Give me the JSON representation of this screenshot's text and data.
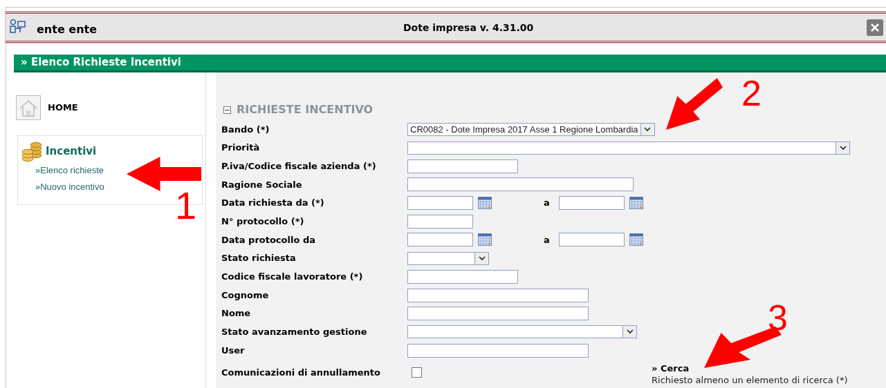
{
  "window": {
    "user": "ente ente",
    "title": "Dote impresa v. 4.31.00"
  },
  "page_header": "» Elenco Richieste Incentivi",
  "sidebar": {
    "home": "HOME",
    "section": "Incentivi",
    "items": [
      {
        "label": "»Elenco richieste"
      },
      {
        "label": "»Nuovo incentivo"
      }
    ]
  },
  "form": {
    "legend": "RICHIESTE INCENTIVO",
    "expanded": true,
    "fields": [
      {
        "label": "Bando (*)",
        "kind": "select",
        "value": "CR0082 - Dote Impresa 2017 Asse 1 Regione Lombardia"
      },
      {
        "label": "Priorità",
        "kind": "select"
      },
      {
        "label": "P.iva/Codice fiscale azienda (*)",
        "kind": "text"
      },
      {
        "label": "Ragione Sociale",
        "kind": "text"
      },
      {
        "label": "Data richiesta da (*)",
        "kind": "date_range",
        "to_label": "a"
      },
      {
        "label": "N° protocollo (*)",
        "kind": "text"
      },
      {
        "label": "Data protocollo da",
        "kind": "date_range",
        "to_label": "a"
      },
      {
        "label": "Stato richiesta",
        "kind": "select"
      },
      {
        "label": "Codice fiscale lavoratore (*)",
        "kind": "text"
      },
      {
        "label": "Cognome",
        "kind": "text"
      },
      {
        "label": "Nome",
        "kind": "text"
      },
      {
        "label": "Stato avanzamento gestione",
        "kind": "select"
      },
      {
        "label": "User",
        "kind": "text"
      },
      {
        "label": "Comunicazioni di annullamento",
        "kind": "checkbox",
        "checked": false
      }
    ],
    "search_link": "» Cerca",
    "search_hint": "Richiesto almeno un elemento di ricerca (*)"
  },
  "annotations": [
    {
      "number": "1"
    },
    {
      "number": "2"
    },
    {
      "number": "3"
    }
  ]
}
